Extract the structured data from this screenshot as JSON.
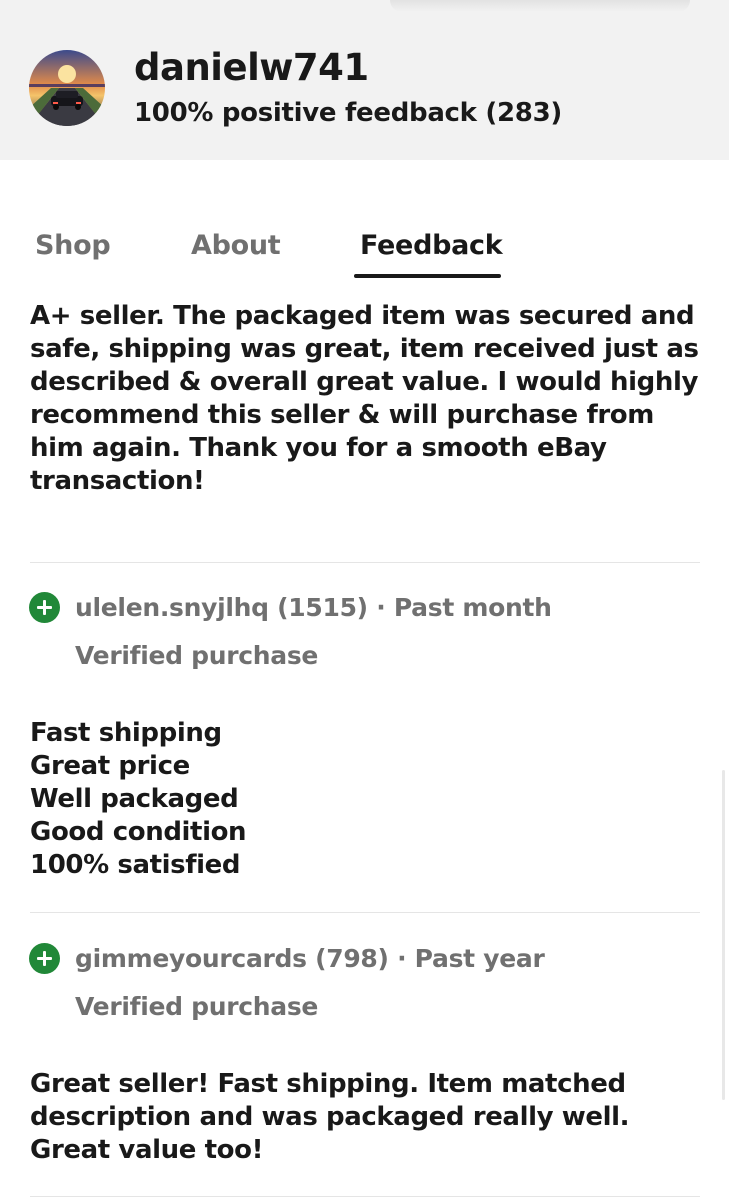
{
  "seller": {
    "username": "danielw741",
    "feedback_summary": "100% positive feedback (283)",
    "avatar_icon": "sunset-car-avatar"
  },
  "tabs": [
    {
      "label": "Shop",
      "active": false
    },
    {
      "label": "About",
      "active": false
    },
    {
      "label": "Feedback",
      "active": true
    }
  ],
  "reviews": [
    {
      "text": "A+ seller. The packaged item was secured and safe, shipping was great, item received just as described & overall great value. I would highly recommend this seller & will purchase from him again. Thank you for a smooth eBay transaction!"
    },
    {
      "icon": "positive-plus-icon",
      "reviewer": "ulelen.snyjlhq (1515)",
      "separator": "·",
      "time": "Past month",
      "verified": "Verified purchase",
      "text_lines": [
        "Fast shipping",
        "Great price",
        "Well packaged",
        "Good condition",
        "100% satisfied"
      ]
    },
    {
      "icon": "positive-plus-icon",
      "reviewer": "gimmeyourcards (798)",
      "separator": "·",
      "time": "Past year",
      "verified": "Verified purchase",
      "text": "Great seller! Fast shipping. Item matched description and was packaged really well. Great value too!"
    }
  ],
  "colors": {
    "positive": "#218838",
    "header_bg": "#f2f2f2",
    "muted_text": "#707070",
    "primary_text": "#191919"
  }
}
